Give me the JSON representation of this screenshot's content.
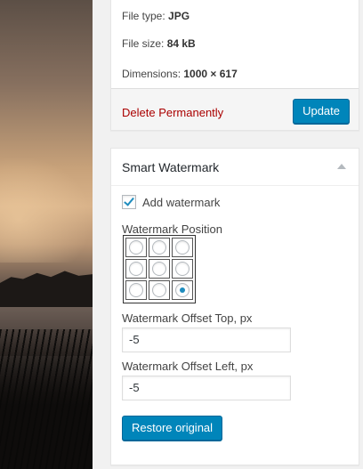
{
  "attachment_info": {
    "file_type_label": "File type:",
    "file_type_value": "JPG",
    "file_size_label": "File size:",
    "file_size_value": "84 kB",
    "dimensions_label": "Dimensions:",
    "dimensions_value": "1000 × 617"
  },
  "actions": {
    "delete_label": "Delete Permanently",
    "update_label": "Update"
  },
  "smart_watermark": {
    "title": "Smart Watermark",
    "add_watermark_label": "Add watermark",
    "add_watermark_checked": true,
    "position_label": "Watermark Position",
    "selected_position": "bottom-right",
    "offset_top_label": "Watermark Offset Top, px",
    "offset_top_value": "-5",
    "offset_left_label": "Watermark Offset Left, px",
    "offset_left_value": "-5",
    "restore_label": "Restore original"
  },
  "colors": {
    "primary_button": "#0085ba",
    "delete_link": "#a00",
    "checkbox_accent": "#1e8cbe"
  }
}
